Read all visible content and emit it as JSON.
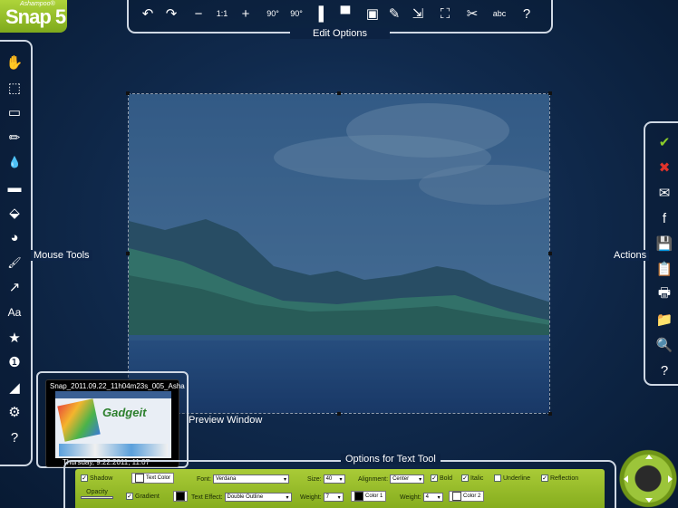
{
  "app": {
    "vendor": "Ashampoo®",
    "name": "Snap 5"
  },
  "edit_toolbar": {
    "label": "Edit Options",
    "buttons": [
      {
        "name": "undo-icon",
        "glyph": "↶"
      },
      {
        "name": "redo-icon",
        "glyph": "↷"
      },
      {
        "name": "zoom-out-icon",
        "glyph": "−"
      },
      {
        "name": "zoom-1to1-icon",
        "glyph": "1:1"
      },
      {
        "name": "zoom-in-icon",
        "glyph": "+"
      },
      {
        "name": "rotate-left-icon",
        "glyph": "90°"
      },
      {
        "name": "rotate-right-icon",
        "glyph": "90°"
      },
      {
        "name": "split-vertical-icon",
        "glyph": "▌"
      },
      {
        "name": "split-horizontal-icon",
        "glyph": "▀"
      },
      {
        "name": "image-icon",
        "glyph": "▣"
      },
      {
        "name": "edit-image-icon",
        "glyph": "✎"
      },
      {
        "name": "resize-image-icon",
        "glyph": "⇲"
      },
      {
        "name": "fullscreen-icon",
        "glyph": "⛶"
      },
      {
        "name": "crop-icon",
        "glyph": "✂"
      },
      {
        "name": "spell-check-icon",
        "glyph": "abc"
      },
      {
        "name": "help-icon",
        "glyph": "?"
      }
    ]
  },
  "mouse_tools": {
    "label": "Mouse Tools",
    "items": [
      {
        "name": "hand-tool-icon",
        "glyph": "✋"
      },
      {
        "name": "selection-tool-icon",
        "glyph": "⬚"
      },
      {
        "name": "eraser-tool-icon",
        "glyph": "▭"
      },
      {
        "name": "pencil-tool-icon",
        "glyph": "✏"
      },
      {
        "name": "blur-tool-icon",
        "glyph": "💧"
      },
      {
        "name": "textbox-tool-icon",
        "glyph": "▬"
      },
      {
        "name": "fill-tool-icon",
        "glyph": "⬙"
      },
      {
        "name": "shapes-tool-icon",
        "glyph": "◕"
      },
      {
        "name": "brush-tool-icon",
        "glyph": "🖌"
      },
      {
        "name": "arrow-tool-icon",
        "glyph": "↗"
      },
      {
        "name": "text-tool-icon",
        "glyph": "Aa"
      },
      {
        "name": "stamp-tool-icon",
        "glyph": "★"
      },
      {
        "name": "numbering-tool-icon",
        "glyph": "❶"
      },
      {
        "name": "spotlight-tool-icon",
        "glyph": "◢"
      },
      {
        "name": "settings-icon",
        "glyph": "⚙"
      },
      {
        "name": "help-icon",
        "glyph": "?"
      }
    ]
  },
  "actions": {
    "label": "Actions",
    "items": [
      {
        "name": "accept-icon",
        "glyph": "✔",
        "color": "#8ccd2a"
      },
      {
        "name": "discard-icon",
        "glyph": "✖",
        "color": "#e0332b"
      },
      {
        "name": "email-icon",
        "glyph": "✉",
        "color": "#ffffff"
      },
      {
        "name": "facebook-icon",
        "glyph": "f",
        "color": "#ffffff"
      },
      {
        "name": "save-icon",
        "glyph": "💾",
        "color": "#ffffff"
      },
      {
        "name": "clipboard-icon",
        "glyph": "📋",
        "color": "#ffffff"
      },
      {
        "name": "print-icon",
        "glyph": "🖶",
        "color": "#ffffff"
      },
      {
        "name": "folder-icon",
        "glyph": "📁",
        "color": "#ffffff"
      },
      {
        "name": "explore-folder-icon",
        "glyph": "🔍",
        "color": "#ffffff"
      },
      {
        "name": "help-icon",
        "glyph": "?",
        "color": "#ffffff"
      }
    ]
  },
  "preview": {
    "label": "Preview Window",
    "title": "Snap_2011.09.22_11h04m23s_005_Asha",
    "date": "Thursday, 9.22.2011, 11:07",
    "thumb_brand": "Gadgeit"
  },
  "text_options": {
    "label": "Options for Text Tool",
    "shadow": "Shadow",
    "text_color": "Text Color",
    "font_label": "Font:",
    "font_value": "Verdana",
    "size_label": "Size:",
    "size_value": "40",
    "alignment_label": "Alignment:",
    "alignment_value": "Center",
    "bold": "Bold",
    "italic": "Italic",
    "underline": "Underline",
    "reflection": "Reflection",
    "opacity": "Opacity",
    "gradient": "Gradient",
    "text_effect_label": "Text Effect:",
    "text_effect_value": "Double Outline",
    "weight_label": "Weight:",
    "weight1_value": "7",
    "color1": "Color 1",
    "weight2_value": "4",
    "color2": "Color 2"
  },
  "colors": {
    "accent_green": "#9cc53a",
    "background_navy": "#102a4d"
  }
}
